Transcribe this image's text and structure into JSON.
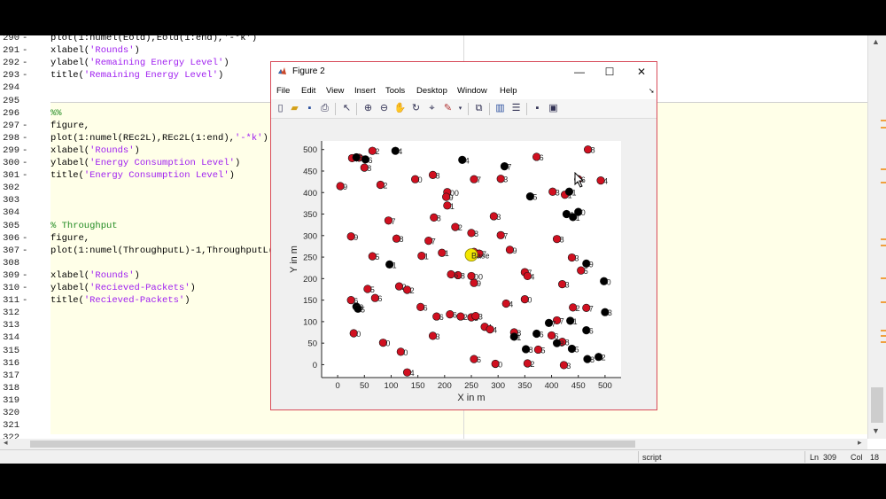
{
  "editor": {
    "lines": [
      {
        "n": "290",
        "dash": "-",
        "parts": [
          {
            "t": "plot(1:numel(Eold),Eold(1:end),'-*k')",
            "c": ""
          }
        ]
      },
      {
        "n": "291",
        "dash": "-",
        "parts": [
          {
            "t": "xlabel(",
            "c": ""
          },
          {
            "t": "'Rounds'",
            "c": "str"
          },
          {
            "t": ")",
            "c": ""
          }
        ]
      },
      {
        "n": "292",
        "dash": "-",
        "parts": [
          {
            "t": "ylabel(",
            "c": ""
          },
          {
            "t": "'Remaining Energy Level'",
            "c": "str"
          },
          {
            "t": ")",
            "c": ""
          }
        ]
      },
      {
        "n": "293",
        "dash": "-",
        "parts": [
          {
            "t": "title(",
            "c": ""
          },
          {
            "t": "'Remaining Energy Level'",
            "c": "str"
          },
          {
            "t": ")",
            "c": ""
          }
        ]
      },
      {
        "n": "294",
        "dash": "",
        "parts": []
      },
      {
        "n": "295",
        "dash": "",
        "parts": []
      },
      {
        "n": "296",
        "dash": "",
        "parts": [
          {
            "t": "%%",
            "c": "cmt"
          }
        ]
      },
      {
        "n": "297",
        "dash": "-",
        "parts": [
          {
            "t": "figure,",
            "c": ""
          }
        ]
      },
      {
        "n": "298",
        "dash": "-",
        "parts": [
          {
            "t": "plot(1:numel(REc2L),REc2L(1:end),",
            "c": ""
          },
          {
            "t": "'-*k'",
            "c": "str"
          },
          {
            "t": ")",
            "c": ""
          }
        ]
      },
      {
        "n": "299",
        "dash": "-",
        "parts": [
          {
            "t": "xlabel(",
            "c": ""
          },
          {
            "t": "'Rounds'",
            "c": "str"
          },
          {
            "t": ")",
            "c": ""
          }
        ]
      },
      {
        "n": "300",
        "dash": "-",
        "parts": [
          {
            "t": "ylabel(",
            "c": ""
          },
          {
            "t": "'Energy Consumption Level'",
            "c": "str"
          },
          {
            "t": ")",
            "c": ""
          }
        ]
      },
      {
        "n": "301",
        "dash": "-",
        "parts": [
          {
            "t": "title(",
            "c": ""
          },
          {
            "t": "'Energy Consumption Level'",
            "c": "str"
          },
          {
            "t": ")",
            "c": ""
          }
        ]
      },
      {
        "n": "302",
        "dash": "",
        "parts": []
      },
      {
        "n": "303",
        "dash": "",
        "parts": []
      },
      {
        "n": "304",
        "dash": "",
        "parts": []
      },
      {
        "n": "305",
        "dash": "",
        "parts": [
          {
            "t": "% Throughput",
            "c": "cmt"
          }
        ]
      },
      {
        "n": "306",
        "dash": "-",
        "parts": [
          {
            "t": "figure,",
            "c": ""
          }
        ]
      },
      {
        "n": "307",
        "dash": "-",
        "parts": [
          {
            "t": "plot(1:numel(ThroughputL)-1,ThroughputL(",
            "c": ""
          }
        ]
      },
      {
        "n": "308",
        "dash": "",
        "parts": []
      },
      {
        "n": "309",
        "dash": "-",
        "parts": [
          {
            "t": "xlabel(",
            "c": ""
          },
          {
            "t": "'Rounds'",
            "c": "str"
          },
          {
            "t": ")",
            "c": ""
          }
        ]
      },
      {
        "n": "310",
        "dash": "-",
        "parts": [
          {
            "t": "ylabel(",
            "c": ""
          },
          {
            "t": "'Recieved-Packets'",
            "c": "str"
          },
          {
            "t": ")",
            "c": ""
          }
        ]
      },
      {
        "n": "311",
        "dash": "-",
        "parts": [
          {
            "t": "title(",
            "c": ""
          },
          {
            "t": "'Recieved-Packets'",
            "c": "str"
          },
          {
            "t": ")",
            "c": ""
          }
        ]
      },
      {
        "n": "312",
        "dash": "",
        "parts": []
      },
      {
        "n": "313",
        "dash": "",
        "parts": []
      },
      {
        "n": "314",
        "dash": "",
        "parts": []
      },
      {
        "n": "315",
        "dash": "",
        "parts": []
      },
      {
        "n": "316",
        "dash": "",
        "parts": []
      },
      {
        "n": "317",
        "dash": "",
        "parts": []
      },
      {
        "n": "318",
        "dash": "",
        "parts": []
      },
      {
        "n": "319",
        "dash": "",
        "parts": []
      },
      {
        "n": "320",
        "dash": "",
        "parts": []
      },
      {
        "n": "321",
        "dash": "",
        "parts": []
      },
      {
        "n": "322",
        "dash": "",
        "parts": []
      }
    ]
  },
  "status": {
    "mode": "script",
    "ln_label": "Ln",
    "ln_value": "309",
    "col_label": "Col",
    "col_value": "18"
  },
  "figure": {
    "title": "Figure 2",
    "menu": [
      "File",
      "Edit",
      "View",
      "Insert",
      "Tools",
      "Desktop",
      "Window",
      "Help"
    ],
    "toolbar_icons": [
      "new-figure-icon",
      "open-file-icon",
      "save-icon",
      "print-icon",
      "pointer-icon",
      "zoom-in-icon",
      "zoom-out-icon",
      "pan-icon",
      "rotate-icon",
      "data-cursor-icon",
      "brush-icon",
      "link-plot-icon",
      "colorbar-icon",
      "legend-icon",
      "hide-plot-tools-icon",
      "show-plot-tools-icon"
    ],
    "minimize": "—",
    "maximize": "☐",
    "close": "✕"
  },
  "chart_data": {
    "type": "scatter",
    "xlabel": "X in m",
    "ylabel": "Y in m",
    "xlim": [
      -30,
      530
    ],
    "ylim": [
      -30,
      520
    ],
    "xticks": [
      0,
      50,
      100,
      150,
      200,
      250,
      300,
      350,
      400,
      450,
      500
    ],
    "yticks": [
      0,
      50,
      100,
      150,
      200,
      250,
      300,
      350,
      400,
      450,
      500
    ],
    "colors": {
      "alive": "#d01020",
      "dead": "#000000",
      "base": "#f2e600"
    },
    "base": {
      "x": 250,
      "y": 255,
      "label": "Base"
    },
    "series": [
      {
        "name": "alive",
        "points": [
          [
            27,
            480,
            "7"
          ],
          [
            40,
            481,
            "6"
          ],
          [
            65,
            497,
            "2"
          ],
          [
            50,
            458,
            "8"
          ],
          [
            5,
            415,
            "9"
          ],
          [
            80,
            418,
            "2"
          ],
          [
            145,
            431,
            "0"
          ],
          [
            178,
            441,
            "8"
          ],
          [
            205,
            401,
            "00"
          ],
          [
            203,
            390,
            "9"
          ],
          [
            205,
            370,
            "1"
          ],
          [
            255,
            431,
            "7"
          ],
          [
            292,
            345,
            "3"
          ],
          [
            220,
            320,
            "2"
          ],
          [
            305,
            432,
            "3"
          ],
          [
            372,
            483,
            "6"
          ],
          [
            468,
            500,
            "8"
          ],
          [
            402,
            402,
            "3"
          ],
          [
            425,
            395,
            "1"
          ],
          [
            450,
            431,
            "6"
          ],
          [
            492,
            428,
            "4"
          ],
          [
            95,
            335,
            "7"
          ],
          [
            180,
            342,
            "8"
          ],
          [
            110,
            293,
            "8"
          ],
          [
            25,
            298,
            "9"
          ],
          [
            170,
            288,
            "7"
          ],
          [
            250,
            306,
            "8"
          ],
          [
            305,
            301,
            "7"
          ],
          [
            322,
            267,
            "9"
          ],
          [
            195,
            260,
            "1"
          ],
          [
            157,
            253,
            "1"
          ],
          [
            65,
            252,
            "5"
          ],
          [
            255,
            262,
            "0"
          ],
          [
            265,
            258,
            "7"
          ],
          [
            250,
            206,
            "00"
          ],
          [
            225,
            208,
            "8"
          ],
          [
            212,
            210,
            "6"
          ],
          [
            255,
            190,
            "9"
          ],
          [
            350,
            215,
            "7"
          ],
          [
            355,
            206,
            "4"
          ],
          [
            410,
            292,
            "8"
          ],
          [
            438,
            249,
            "3"
          ],
          [
            455,
            219,
            "5"
          ],
          [
            420,
            187,
            "3"
          ],
          [
            56,
            176,
            "5"
          ],
          [
            115,
            182,
            "2"
          ],
          [
            130,
            174,
            "2"
          ],
          [
            25,
            150,
            "6"
          ],
          [
            70,
            155,
            "6"
          ],
          [
            155,
            134,
            "6"
          ],
          [
            185,
            112,
            "6"
          ],
          [
            210,
            117,
            "6"
          ],
          [
            230,
            112,
            "2"
          ],
          [
            250,
            110,
            "3"
          ],
          [
            258,
            113,
            "3"
          ],
          [
            315,
            142,
            "4"
          ],
          [
            350,
            152,
            "0"
          ],
          [
            440,
            133,
            "2"
          ],
          [
            465,
            132,
            "7"
          ],
          [
            410,
            103,
            "7"
          ],
          [
            275,
            88,
            "4"
          ],
          [
            285,
            82,
            "4"
          ],
          [
            330,
            75,
            "8"
          ],
          [
            400,
            68,
            "6"
          ],
          [
            30,
            73,
            "0"
          ],
          [
            85,
            51,
            "0"
          ],
          [
            118,
            30,
            "0"
          ],
          [
            178,
            67,
            "3"
          ],
          [
            255,
            13,
            "6"
          ],
          [
            295,
            2,
            "0"
          ],
          [
            355,
            3,
            "2"
          ],
          [
            423,
            -1,
            "3"
          ],
          [
            375,
            35,
            "5"
          ],
          [
            420,
            53,
            "8"
          ],
          [
            130,
            -18,
            "4"
          ]
        ]
      },
      {
        "name": "dead",
        "points": [
          [
            35,
            482,
            "8"
          ],
          [
            52,
            477,
            "6"
          ],
          [
            108,
            497,
            "4"
          ],
          [
            233,
            476,
            "4"
          ],
          [
            312,
            461,
            "7"
          ],
          [
            360,
            391,
            "5"
          ],
          [
            433,
            402,
            "1"
          ],
          [
            428,
            350,
            "4"
          ],
          [
            440,
            343,
            "1"
          ],
          [
            450,
            355,
            "0"
          ],
          [
            465,
            235,
            "9"
          ],
          [
            498,
            194,
            "0"
          ],
          [
            97,
            233,
            "1"
          ],
          [
            35,
            135,
            "8"
          ],
          [
            38,
            130,
            "5"
          ],
          [
            500,
            122,
            "3"
          ],
          [
            435,
            102,
            "1"
          ],
          [
            395,
            97,
            "7"
          ],
          [
            465,
            80,
            "6"
          ],
          [
            330,
            65,
            "1"
          ],
          [
            372,
            72,
            "6"
          ],
          [
            410,
            50,
            "8"
          ],
          [
            438,
            37,
            "5"
          ],
          [
            352,
            36,
            "8"
          ],
          [
            488,
            18,
            "2"
          ],
          [
            467,
            13,
            "8"
          ]
        ]
      }
    ]
  }
}
